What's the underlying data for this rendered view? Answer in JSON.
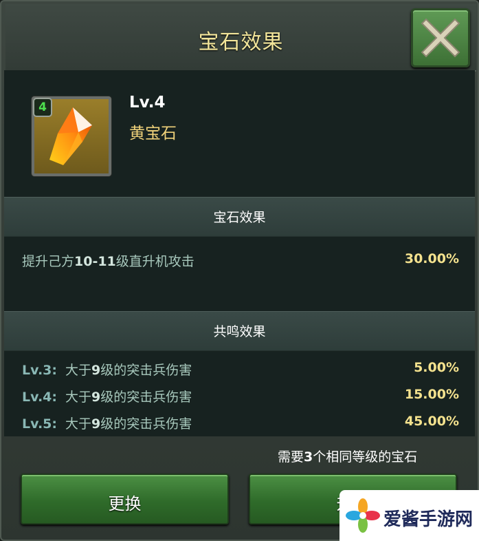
{
  "title": "宝石效果",
  "gem": {
    "badge": "4",
    "level": "Lv.4",
    "name": "黄宝石"
  },
  "gem_effect": {
    "header": "宝石效果",
    "rows": [
      {
        "desc_pre": "提升己方",
        "desc_bold": "10-11",
        "desc_post": "级直升机攻击",
        "value": "30.00%"
      }
    ]
  },
  "resonance": {
    "header": "共鸣效果",
    "rows": [
      {
        "lv": "Lv.3:",
        "desc_pre": "大于",
        "desc_bold": "9",
        "desc_post": "级的突击兵伤害",
        "value": "5.00%"
      },
      {
        "lv": "Lv.4:",
        "desc_pre": "大于",
        "desc_bold": "9",
        "desc_post": "级的突击兵伤害",
        "value": "15.00%"
      },
      {
        "lv": "Lv.5:",
        "desc_pre": "大于",
        "desc_bold": "9",
        "desc_post": "级的突击兵伤害",
        "value": "45.00%"
      }
    ]
  },
  "requirement": {
    "pre": "需要",
    "bold": "3",
    "post": "个相同等级的宝石"
  },
  "buttons": {
    "replace": "更换",
    "upgrade": "升级"
  },
  "watermark": {
    "text": "爱酱手游网"
  }
}
